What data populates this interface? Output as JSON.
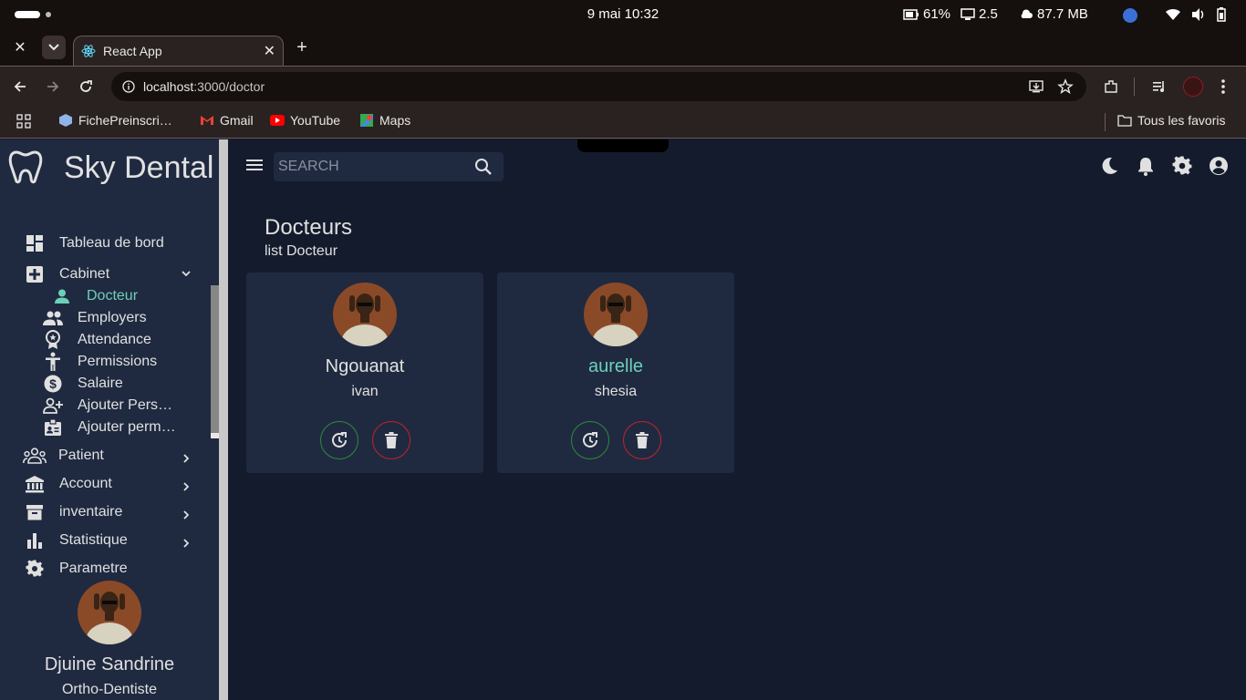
{
  "os": {
    "clock": "9 mai  10:32",
    "battery": "61%",
    "displays": "2.5",
    "memory": "87.7 MB"
  },
  "browser": {
    "tab_title": "React App",
    "url_host": "localhost",
    "url_path": ":3000/doctor",
    "bookmarks": [
      "FichePreinscri…",
      "Gmail",
      "YouTube",
      "Maps"
    ],
    "all_bookmarks": "Tous les favoris"
  },
  "sidebar": {
    "brand": "Sky Dental",
    "items": [
      {
        "label": "Tableau de bord",
        "icon": "dashboard-icon"
      },
      {
        "label": "Cabinet",
        "icon": "medical-plus-icon"
      },
      {
        "label": "Docteur",
        "icon": "person-icon"
      },
      {
        "label": "Employers",
        "icon": "people-icon"
      },
      {
        "label": "Attendance",
        "icon": "award-icon"
      },
      {
        "label": "Permissions",
        "icon": "accessibility-icon"
      },
      {
        "label": "Salaire",
        "icon": "dollar-icon"
      },
      {
        "label": "Ajouter Pers…",
        "icon": "person-add-icon"
      },
      {
        "label": "Ajouter perm…",
        "icon": "badge-icon"
      },
      {
        "label": "Patient",
        "icon": "groups-icon"
      },
      {
        "label": "Account",
        "icon": "bank-icon"
      },
      {
        "label": "inventaire",
        "icon": "archive-icon"
      },
      {
        "label": "Statistique",
        "icon": "bar-chart-icon"
      },
      {
        "label": "Parametre",
        "icon": "gear-icon"
      }
    ],
    "profile": {
      "name": "Djuine Sandrine",
      "role": "Ortho-Dentiste"
    }
  },
  "topbar": {
    "search_placeholder": "SEARCH"
  },
  "page": {
    "title": "Docteurs",
    "subtitle": "list Docteur"
  },
  "doctors": [
    {
      "last_name": "Ngouanat",
      "first_name": "ivan"
    },
    {
      "last_name": "aurelle",
      "first_name": "shesia"
    }
  ],
  "colors": {
    "accent": "#6ccfb8",
    "sidebar_bg": "#1f2a40",
    "main_bg": "#141b2d",
    "edit_green": "#2e8b3d",
    "delete_red": "#c8202b"
  }
}
